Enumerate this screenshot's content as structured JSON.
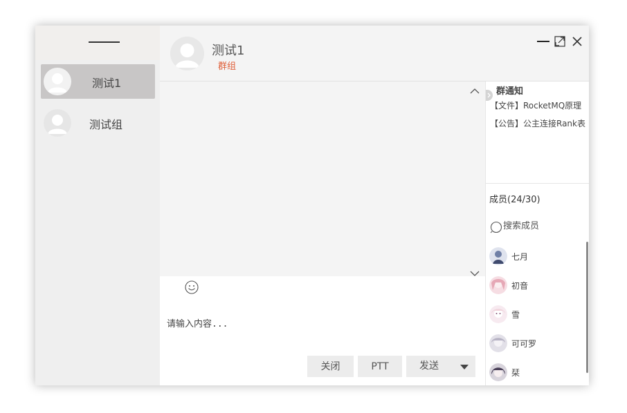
{
  "sidebar": {
    "chats": [
      {
        "name": "测试1",
        "active": true
      },
      {
        "name": "测试组",
        "active": false
      }
    ]
  },
  "header": {
    "name": "测试1",
    "type": "群组"
  },
  "input": {
    "placeholder": "请输入内容..."
  },
  "buttons": {
    "close": "关闭",
    "ptt": "PTT",
    "send": "发送"
  },
  "notice": {
    "title": "群通知",
    "items": [
      "【文件】RocketMQ原理",
      "【公告】公主连接Rank表"
    ]
  },
  "members": {
    "title": "成员(24/30)",
    "search_placeholder": "搜索成员",
    "list": [
      {
        "name": "七月",
        "color": "#6f7fa6"
      },
      {
        "name": "初音",
        "color": "#e6a8b6"
      },
      {
        "name": "雪",
        "color": "#f0d4dc"
      },
      {
        "name": "可可罗",
        "color": "#b7b3c4"
      },
      {
        "name": "栞",
        "color": "#4a4058"
      }
    ]
  },
  "colors": {
    "accent": "#e0603a",
    "active_item": "#c8c6c6"
  }
}
